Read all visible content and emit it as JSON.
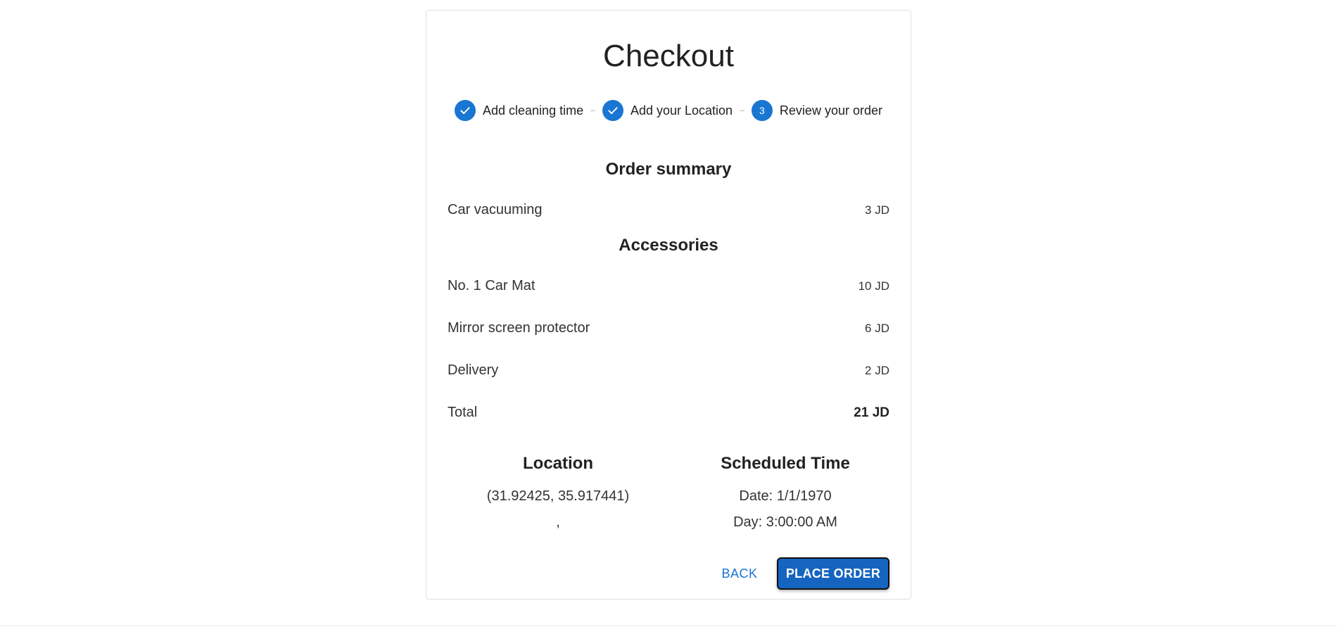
{
  "page": {
    "title": "Checkout"
  },
  "stepper": {
    "steps": [
      {
        "label": "Add cleaning time",
        "state": "completed",
        "icon": "check-icon"
      },
      {
        "label": "Add your Location",
        "state": "completed",
        "icon": "check-icon"
      },
      {
        "label": "Review your order",
        "state": "active",
        "number": "3"
      }
    ]
  },
  "summary": {
    "title": "Order summary",
    "service": {
      "name": "Car vacuuming",
      "price": "3 JD"
    },
    "accessories_title": "Accessories",
    "accessories": [
      {
        "name": "No. 1 Car Mat",
        "price": "10 JD"
      },
      {
        "name": "Mirror screen protector",
        "price": "6 JD"
      }
    ],
    "delivery": {
      "name": "Delivery",
      "price": "2 JD"
    },
    "total": {
      "name": "Total",
      "price": "21 JD"
    }
  },
  "location": {
    "title": "Location",
    "coords": "(31.92425, 35.917441)",
    "address": ","
  },
  "schedule": {
    "title": "Scheduled Time",
    "date": "Date: 1/1/1970",
    "day": "Day: 3:00:00 AM"
  },
  "actions": {
    "back_label": "BACK",
    "place_order_label": "PLACE ORDER"
  },
  "colors": {
    "primary": "#1976d2",
    "primary_dark": "#1565c0"
  }
}
